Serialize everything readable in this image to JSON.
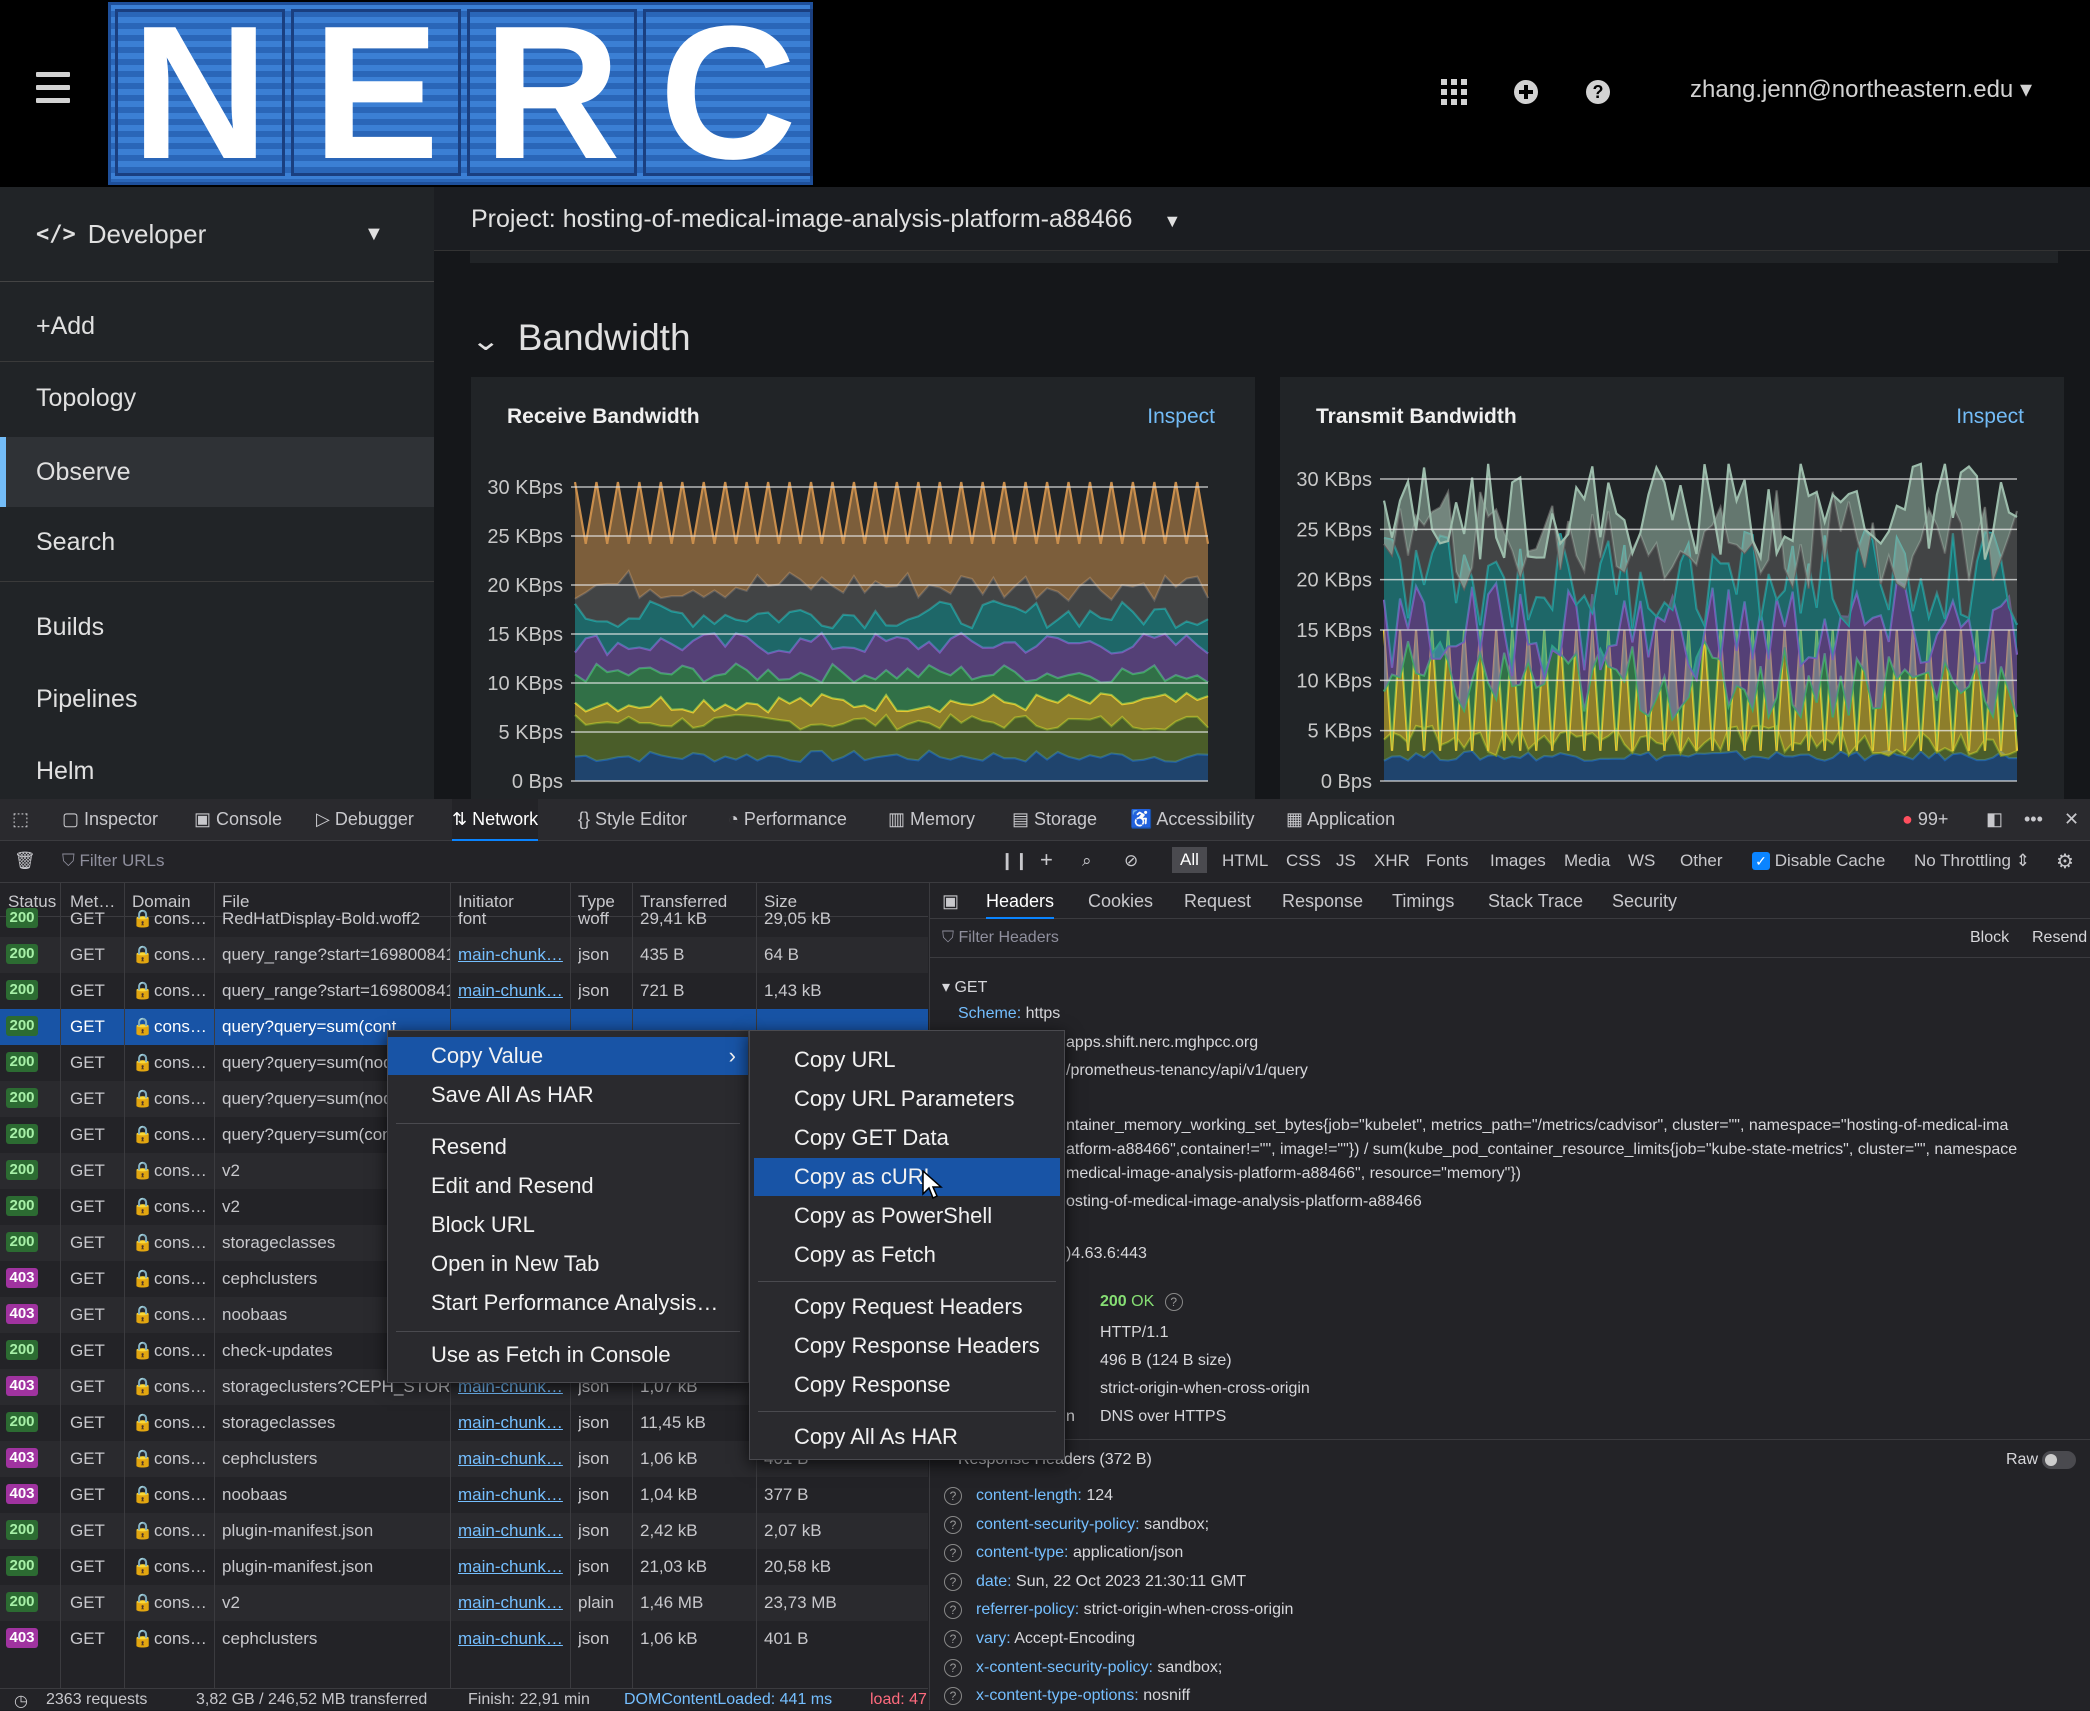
{
  "header": {
    "logo_letters": [
      "N",
      "E",
      "R",
      "C"
    ],
    "user": "zhang.jenn@northeastern.edu"
  },
  "sidebar": {
    "perspective": "Developer",
    "items": [
      {
        "label": "+Add"
      },
      {
        "label": "Topology"
      },
      {
        "label": "Observe",
        "active": true
      },
      {
        "label": "Search"
      },
      {
        "label": "Builds"
      },
      {
        "label": "Pipelines"
      },
      {
        "label": "Helm"
      }
    ]
  },
  "main": {
    "project": "Project: hosting-of-medical-image-analysis-platform-a88466",
    "section_title": "Bandwidth",
    "panels": [
      {
        "title": "Receive Bandwidth",
        "action": "Inspect"
      },
      {
        "title": "Transmit Bandwidth",
        "action": "Inspect"
      }
    ]
  },
  "chart_data": [
    {
      "type": "area",
      "title": "Receive Bandwidth",
      "y_ticks": [
        "30 KBps",
        "25 KBps",
        "20 KBps",
        "15 KBps",
        "10 KBps",
        "5 KBps",
        "0 Bps"
      ],
      "ylim": [
        0,
        30
      ],
      "unit": "KBps",
      "stacked": true,
      "series_colors": [
        "#1f5fa8",
        "#6d8c2c",
        "#e8c830",
        "#3fae62",
        "#7f58b8",
        "#1d9f9f",
        "#5e5e5e",
        "#c98e4c"
      ],
      "series_levels": [
        2.5,
        6,
        8,
        11,
        14,
        17,
        20,
        27
      ],
      "jitter": [
        0.6,
        0.8,
        1.0,
        1.0,
        1.2,
        1.4,
        1.6,
        3.5
      ],
      "x_points": 60
    },
    {
      "type": "area",
      "title": "Transmit Bandwidth",
      "y_ticks": [
        "30 KBps",
        "25 KBps",
        "20 KBps",
        "15 KBps",
        "10 KBps",
        "5 KBps",
        "0 Bps"
      ],
      "ylim": [
        0,
        30
      ],
      "unit": "KBps",
      "stacked": true,
      "series_colors": [
        "#1f5fa8",
        "#6d8c2c",
        "#e8c830",
        "#3fae62",
        "#7f58b8",
        "#1d9f9f",
        "#5e5e5e",
        "#9cbcab"
      ],
      "series_levels": [
        2.5,
        4,
        6,
        10,
        15,
        20,
        24,
        27
      ],
      "jitter": [
        0.5,
        1.5,
        10,
        4,
        5,
        5,
        5,
        5
      ],
      "x_points": 80
    }
  ],
  "devtools": {
    "tabs": [
      "Inspector",
      "Console",
      "Debugger",
      "Network",
      "Style Editor",
      "Performance",
      "Memory",
      "Storage",
      "Accessibility",
      "Application"
    ],
    "selected_tab": "Network",
    "error_count": "99+",
    "filter_placeholder": "Filter URLs",
    "type_filters": [
      "All",
      "HTML",
      "CSS",
      "JS",
      "XHR",
      "Fonts",
      "Images",
      "Media",
      "WS",
      "Other"
    ],
    "disable_cache": "Disable Cache",
    "throttling": "No Throttling",
    "columns": [
      "Status",
      "Met…",
      "Domain",
      "File",
      "Initiator",
      "Type",
      "Transferred",
      "Size"
    ],
    "rows": [
      {
        "status": "200",
        "method": "GET",
        "domain": "cons…",
        "file": "RedHatDisplay-Bold.woff2",
        "initiator": "font",
        "init_link": false,
        "type": "woff",
        "transferred": "29,41 kB",
        "size": "29,05 kB"
      },
      {
        "status": "200",
        "method": "GET",
        "domain": "cons…",
        "file": "query_range?start=169800841",
        "initiator": "main-chunk…",
        "init_link": true,
        "type": "json",
        "transferred": "435 B",
        "size": "64 B"
      },
      {
        "status": "200",
        "method": "GET",
        "domain": "cons…",
        "file": "query_range?start=169800841",
        "initiator": "main-chunk…",
        "init_link": true,
        "type": "json",
        "transferred": "721 B",
        "size": "1,43 kB"
      },
      {
        "status": "200",
        "method": "GET",
        "domain": "cons…",
        "file": "query?query=sum(cont",
        "initiator": "",
        "init_link": false,
        "type": "",
        "transferred": "",
        "size": "",
        "selected": true
      },
      {
        "status": "200",
        "method": "GET",
        "domain": "cons…",
        "file": "query?query=sum(nod",
        "initiator": "",
        "init_link": false,
        "type": "",
        "transferred": "",
        "size": ""
      },
      {
        "status": "200",
        "method": "GET",
        "domain": "cons…",
        "file": "query?query=sum(nod",
        "initiator": "",
        "init_link": false,
        "type": "",
        "transferred": "",
        "size": ""
      },
      {
        "status": "200",
        "method": "GET",
        "domain": "cons…",
        "file": "query?query=sum(con",
        "initiator": "",
        "init_link": false,
        "type": "",
        "transferred": "",
        "size": ""
      },
      {
        "status": "200",
        "method": "GET",
        "domain": "cons…",
        "file": "v2",
        "initiator": "",
        "init_link": false,
        "type": "",
        "transferred": "",
        "size": ""
      },
      {
        "status": "200",
        "method": "GET",
        "domain": "cons…",
        "file": "v2",
        "initiator": "",
        "init_link": false,
        "type": "",
        "transferred": "",
        "size": ""
      },
      {
        "status": "200",
        "method": "GET",
        "domain": "cons…",
        "file": "storageclasses",
        "initiator": "",
        "init_link": false,
        "type": "",
        "transferred": "",
        "size": ""
      },
      {
        "status": "403",
        "method": "GET",
        "domain": "cons…",
        "file": "cephclusters",
        "initiator": "",
        "init_link": false,
        "type": "",
        "transferred": "",
        "size": ""
      },
      {
        "status": "403",
        "method": "GET",
        "domain": "cons…",
        "file": "noobaas",
        "initiator": "",
        "init_link": false,
        "type": "",
        "transferred": "",
        "size": ""
      },
      {
        "status": "200",
        "method": "GET",
        "domain": "cons…",
        "file": "check-updates",
        "initiator": "",
        "init_link": false,
        "type": "",
        "transferred": "",
        "size": ""
      },
      {
        "status": "403",
        "method": "GET",
        "domain": "cons…",
        "file": "storageclusters?CEPH_STORAG",
        "initiator": "main-chunk…",
        "init_link": true,
        "type": "json",
        "transferred": "1,07 kB",
        "size": ""
      },
      {
        "status": "200",
        "method": "GET",
        "domain": "cons…",
        "file": "storageclasses",
        "initiator": "main-chunk…",
        "init_link": true,
        "type": "json",
        "transferred": "11,45 kB",
        "size": ""
      },
      {
        "status": "403",
        "method": "GET",
        "domain": "cons…",
        "file": "cephclusters",
        "initiator": "main-chunk…",
        "init_link": true,
        "type": "json",
        "transferred": "1,06 kB",
        "size": "401 B"
      },
      {
        "status": "403",
        "method": "GET",
        "domain": "cons…",
        "file": "noobaas",
        "initiator": "main-chunk…",
        "init_link": true,
        "type": "json",
        "transferred": "1,04 kB",
        "size": "377 B"
      },
      {
        "status": "200",
        "method": "GET",
        "domain": "cons…",
        "file": "plugin-manifest.json",
        "initiator": "main-chunk…",
        "init_link": true,
        "type": "json",
        "transferred": "2,42 kB",
        "size": "2,07 kB"
      },
      {
        "status": "200",
        "method": "GET",
        "domain": "cons…",
        "file": "plugin-manifest.json",
        "initiator": "main-chunk…",
        "init_link": true,
        "type": "json",
        "transferred": "21,03 kB",
        "size": "20,58 kB"
      },
      {
        "status": "200",
        "method": "GET",
        "domain": "cons…",
        "file": "v2",
        "initiator": "main-chunk…",
        "init_link": true,
        "type": "plain",
        "transferred": "1,46 MB",
        "size": "23,73 MB"
      },
      {
        "status": "403",
        "method": "GET",
        "domain": "cons…",
        "file": "cephclusters",
        "initiator": "main-chunk…",
        "init_link": true,
        "type": "json",
        "transferred": "1,06 kB",
        "size": "401 B"
      }
    ],
    "status_bar": {
      "requests": "2363 requests",
      "transferred": "3,82 GB / 246,52 MB transferred",
      "finish": "Finish: 22,91 min",
      "dcl": "DOMContentLoaded: 441 ms",
      "load": "load: 47"
    },
    "detail_tabs": [
      "Headers",
      "Cookies",
      "Request",
      "Response",
      "Timings",
      "Stack Trace",
      "Security"
    ],
    "detail_selected": "Headers",
    "filter_headers": "Filter Headers",
    "block": "Block",
    "resend": "Resend",
    "method": "GET",
    "scheme_label": "Scheme:",
    "scheme_value": "https",
    "host_fragment": "apps.shift.nerc.mghpcc.org",
    "path_fragment": "/prometheus-tenancy/api/v1/query",
    "query_lines": [
      "ntainer_memory_working_set_bytes{job=\"kubelet\", metrics_path=\"/metrics/cadvisor\", cluster=\"\", namespace=\"hosting-of-medical-ima",
      "atform-a88466\",container!=\"\", image!=\"\"}) / sum(kube_pod_container_resource_limits{job=\"kube-state-metrics\", cluster=\"\", namespace",
      "medical-image-analysis-platform-a88466\", resource=\"memory\"})",
      "osting-of-medical-image-analysis-platform-a88466"
    ],
    "address_fragment": ")4.63.6:443",
    "status_code": "200",
    "status_text": "OK",
    "version": "HTTP/1.1",
    "transferred_detail": "496 B (124 B size)",
    "referrer_policy": "strict-origin-when-cross-origin",
    "dns_label_fragment": "n",
    "dns": "DNS over HTTPS",
    "response_headers_label": "Response Headers (372 B)",
    "raw": "Raw",
    "response_headers": [
      {
        "k": "content-length:",
        "v": "124"
      },
      {
        "k": "content-security-policy:",
        "v": "sandbox;"
      },
      {
        "k": "content-type:",
        "v": "application/json"
      },
      {
        "k": "date:",
        "v": "Sun, 22 Oct 2023 21:30:11 GMT"
      },
      {
        "k": "referrer-policy:",
        "v": "strict-origin-when-cross-origin"
      },
      {
        "k": "vary:",
        "v": "Accept-Encoding"
      },
      {
        "k": "x-content-security-policy:",
        "v": "sandbox;"
      },
      {
        "k": "x-content-type-options:",
        "v": "nosniff"
      }
    ]
  },
  "context_menu": {
    "items": [
      "Copy Value",
      "Save All As HAR",
      "Resend",
      "Edit and Resend",
      "Block URL",
      "Open in New Tab",
      "Start Performance Analysis…",
      "Use as Fetch in Console"
    ],
    "submenu": [
      "Copy URL",
      "Copy URL Parameters",
      "Copy GET Data",
      "Copy as cURL",
      "Copy as PowerShell",
      "Copy as Fetch",
      "Copy Request Headers",
      "Copy Response Headers",
      "Copy Response",
      "Copy All As HAR"
    ],
    "highlighted": "Copy as cURL"
  }
}
